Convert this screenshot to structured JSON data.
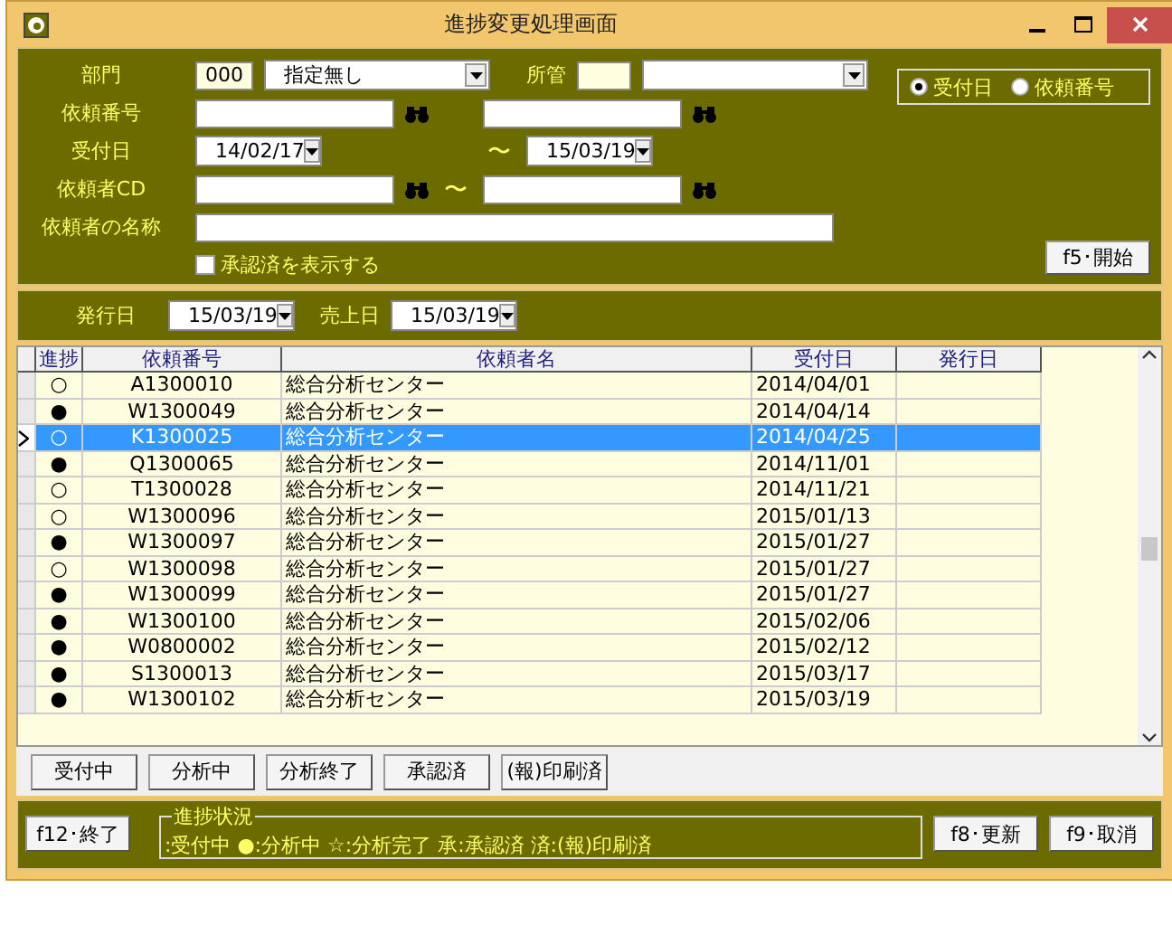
{
  "window": {
    "title": "進捗変更処理画面"
  },
  "filters": {
    "department": {
      "label": "部門",
      "code": "000",
      "value": "指定無し"
    },
    "jurisdiction": {
      "label": "所管"
    },
    "sort_by": [
      {
        "label": "受付日",
        "selected": true
      },
      {
        "label": "依頼番号",
        "selected": false
      }
    ],
    "request_number": {
      "label": "依頼番号"
    },
    "received_date": {
      "label": "受付日",
      "from": "14/02/17",
      "separator": "〜",
      "to": "15/03/19"
    },
    "requester_cd": {
      "label": "依頼者CD",
      "separator": "〜"
    },
    "requester_name": {
      "label": "依頼者の名称"
    },
    "show_approved": {
      "label": "承認済を表示する",
      "checked": false
    },
    "start_button": "f5･開始"
  },
  "dates": {
    "issue_date": {
      "label": "発行日",
      "value": "15/03/19"
    },
    "sales_date": {
      "label": "売上日",
      "value": "15/03/19"
    }
  },
  "table": {
    "columns": [
      "進捗",
      "依頼番号",
      "依頼者名",
      "受付日",
      "発行日"
    ],
    "rows": [
      {
        "progress": "○",
        "request_number": "A1300010",
        "requester": "総合分析センター",
        "received_date": "2014/04/01",
        "selected": false
      },
      {
        "progress": "●",
        "request_number": "W1300049",
        "requester": "総合分析センター",
        "received_date": "2014/04/14",
        "selected": false
      },
      {
        "progress": "○",
        "request_number": "K1300025",
        "requester": "総合分析センター",
        "received_date": "2014/04/25",
        "selected": true
      },
      {
        "progress": "●",
        "request_number": "Q1300065",
        "requester": "総合分析センター",
        "received_date": "2014/11/01",
        "selected": false
      },
      {
        "progress": "○",
        "request_number": "T1300028",
        "requester": "総合分析センター",
        "received_date": "2014/11/21",
        "selected": false
      },
      {
        "progress": "○",
        "request_number": "W1300096",
        "requester": "総合分析センター",
        "received_date": "2015/01/13",
        "selected": false
      },
      {
        "progress": "●",
        "request_number": "W1300097",
        "requester": "総合分析センター",
        "received_date": "2015/01/27",
        "selected": false
      },
      {
        "progress": "○",
        "request_number": "W1300098",
        "requester": "総合分析センター",
        "received_date": "2015/01/27",
        "selected": false
      },
      {
        "progress": "●",
        "request_number": "W1300099",
        "requester": "総合分析センター",
        "received_date": "2015/01/27",
        "selected": false
      },
      {
        "progress": "●",
        "request_number": "W1300100",
        "requester": "総合分析センター",
        "received_date": "2015/02/06",
        "selected": false
      },
      {
        "progress": "●",
        "request_number": "W0800002",
        "requester": "総合分析センター",
        "received_date": "2015/02/12",
        "selected": false
      },
      {
        "progress": "●",
        "request_number": "S1300013",
        "requester": "総合分析センター",
        "received_date": "2015/03/17",
        "selected": false
      },
      {
        "progress": "●",
        "request_number": "W1300102",
        "requester": "総合分析センター",
        "received_date": "2015/03/19",
        "selected": false
      }
    ]
  },
  "status_buttons": [
    "受付中",
    "分析中",
    "分析終了",
    "承認済",
    "(報)印刷済"
  ],
  "footer": {
    "exit_button": "f12･終了",
    "legend_title": "進捗状況",
    "legend_text": ":受付中 ●:分析中 ☆:分析完了 承:承認済 済:(報)印刷済",
    "update_button": "f8･更新",
    "cancel_button": "f9･取消"
  }
}
